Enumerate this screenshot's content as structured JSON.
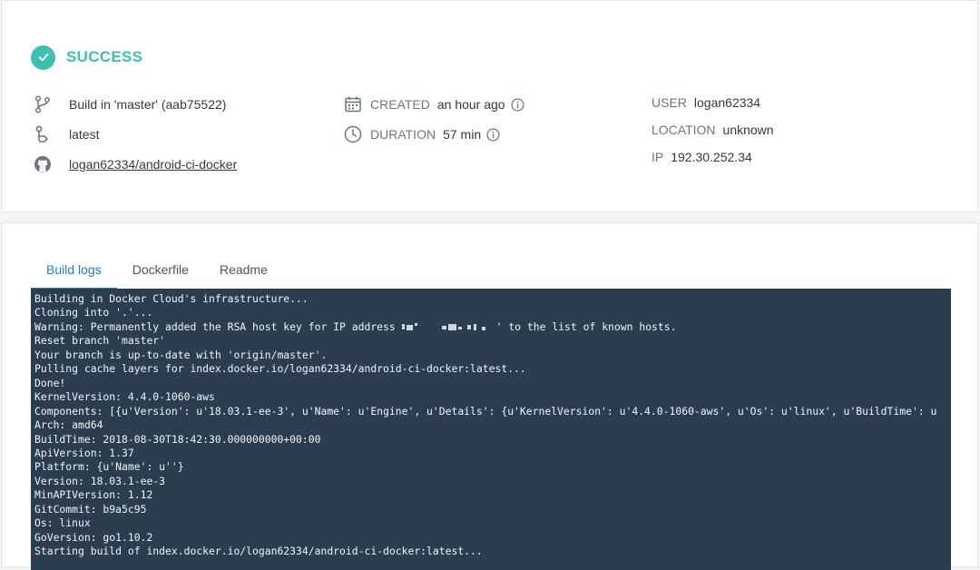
{
  "build": {
    "status": "SUCCESS",
    "branch_text": "Build in 'master' (aab75522)",
    "tag": "latest",
    "repo": "logan62334/android-ci-docker",
    "created_label": "CREATED",
    "created_value": "an hour ago",
    "duration_label": "DURATION",
    "duration_value": "57 min",
    "user_label": "USER",
    "user_value": "logan62334",
    "location_label": "LOCATION",
    "location_value": "unknown",
    "ip_label": "IP",
    "ip_value": "192.30.252.34"
  },
  "tabs": [
    {
      "label": "Build logs",
      "active": true
    },
    {
      "label": "Dockerfile",
      "active": false
    },
    {
      "label": "Readme",
      "active": false
    }
  ],
  "logs": {
    "line_warning_prefix": "Warning: Permanently added the RSA host key for IP address ",
    "line_warning_suffix": "' to the list of known hosts.",
    "lines": [
      "Building in Docker Cloud's infrastructure...",
      "Cloning into '.'...",
      "",
      "Reset branch 'master'",
      "Your branch is up-to-date with 'origin/master'.",
      "Pulling cache layers for index.docker.io/logan62334/android-ci-docker:latest...",
      "Done!",
      "KernelVersion: 4.4.0-1060-aws",
      "Components: [{u'Version': u'18.03.1-ee-3', u'Name': u'Engine', u'Details': {u'KernelVersion': u'4.4.0-1060-aws', u'Os': u'linux', u'BuildTime': u",
      "Arch: amd64",
      "BuildTime: 2018-08-30T18:42:30.000000000+00:00",
      "ApiVersion: 1.37",
      "Platform: {u'Name': u''}",
      "Version: 18.03.1-ee-3",
      "MinAPIVersion: 1.12",
      "GitCommit: b9a5c95",
      "Os: linux",
      "GoVersion: go1.10.2",
      "Starting build of index.docker.io/logan62334/android-ci-docker:latest..."
    ]
  },
  "colors": {
    "success": "#3fbeb4",
    "tab_active": "#1f7bc9",
    "log_background": "#2b3e4f"
  },
  "icons": [
    "check-icon",
    "git-branch-icon",
    "tag-icon",
    "github-icon",
    "calendar-icon",
    "clock-icon",
    "info-icon"
  ]
}
